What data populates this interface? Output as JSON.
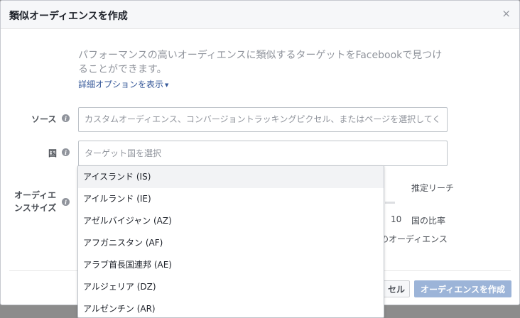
{
  "modal": {
    "title": "類似オーディエンスを作成",
    "close_glyph": "×"
  },
  "description": {
    "line1": "パフォーマンスの高いオーディエンスに類似するターゲットをFacebookで見つけ",
    "line2": "ることができます。"
  },
  "advanced_options": {
    "label": "詳細オプションを表示",
    "caret": "▼"
  },
  "source": {
    "label": "ソース",
    "placeholder": "カスタムオーディエンス、コンバージョントラッキングピクセル、またはページを選択してく"
  },
  "country": {
    "label": "国",
    "placeholder": "ターゲット国を選択"
  },
  "audience_size": {
    "label_line1": "オーディエ",
    "label_line2": "ンスサイズ"
  },
  "side_panel": {
    "estimated_reach": "推定リーチ",
    "scale_value": "10",
    "country_ratio": "国の比率",
    "audience_partial": "のオーディエンス"
  },
  "footer": {
    "cancel_partial": "セル",
    "create_label": "オーディエンスを作成"
  },
  "dropdown_options": [
    "アイスランド (IS)",
    "アイルランド (IE)",
    "アゼルバイジャン (AZ)",
    "アフガニスタン (AF)",
    "アラブ首長国連邦 (AE)",
    "アルジェリア (DZ)",
    "アルゼンチン (AR)"
  ],
  "colors": {
    "link": "#365899",
    "primary_button_disabled": "#9cb4d8",
    "muted_text": "#90949c"
  }
}
